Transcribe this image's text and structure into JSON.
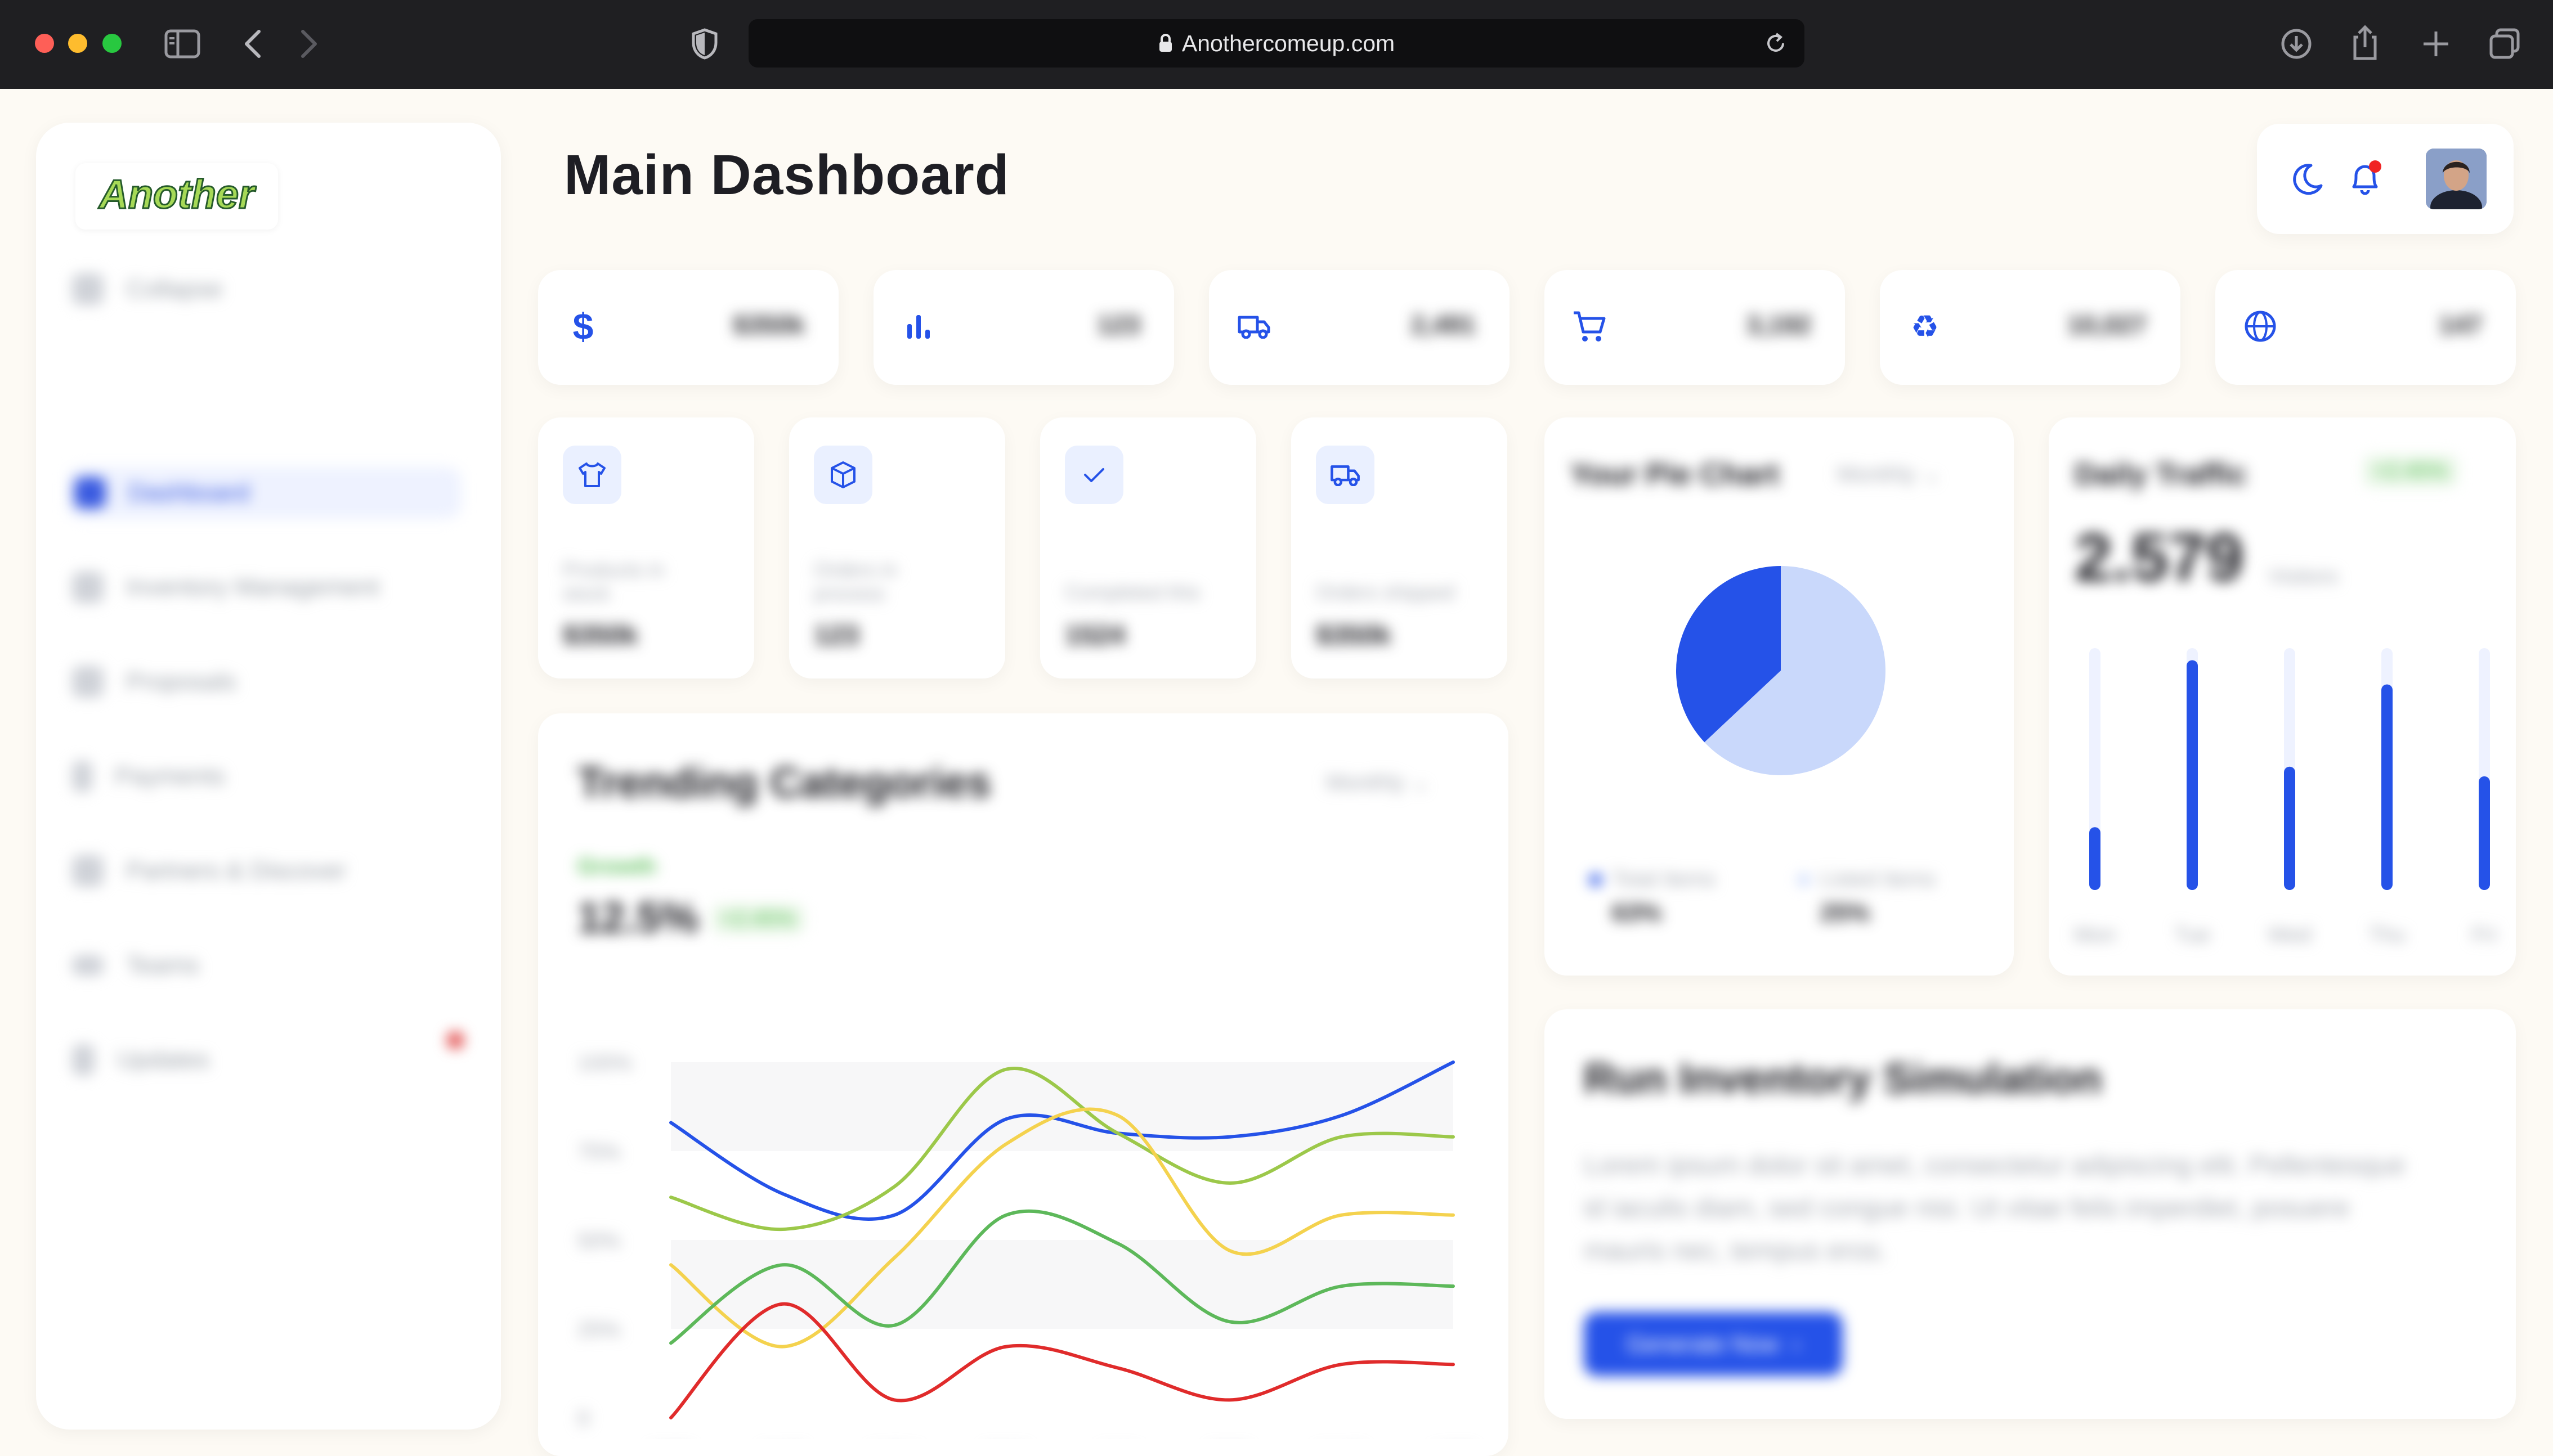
{
  "browser": {
    "url": "Anothercomeup.com"
  },
  "brand": {
    "logo_text": "Another",
    "accent": "#2552e8",
    "accent_light": "#c9d8fb"
  },
  "sidebar": {
    "collapse_label": "Collapse",
    "items": [
      {
        "label": "Dashboard"
      },
      {
        "label": "Inventory Management"
      },
      {
        "label": "Proposals"
      },
      {
        "label": "Payments"
      },
      {
        "label": "Partners & Discover"
      },
      {
        "label": "Teams"
      },
      {
        "label": "Updates"
      }
    ]
  },
  "header": {
    "title": "Main Dashboard"
  },
  "stats": [
    {
      "icon": "dollar-icon",
      "value": "$350k"
    },
    {
      "icon": "bar-chart-icon",
      "value": "123"
    },
    {
      "icon": "truck-icon",
      "value": "2,491"
    },
    {
      "icon": "cart-icon",
      "value": "3,192"
    },
    {
      "icon": "recycle-icon",
      "value": "10,027"
    },
    {
      "icon": "globe-icon",
      "value": "147"
    }
  ],
  "mini_cards": [
    {
      "icon": "shirt-icon",
      "label": "Products in stock",
      "value": "$350k"
    },
    {
      "icon": "box-icon",
      "label": "Orders in process",
      "value": "123"
    },
    {
      "icon": "check-icon",
      "label": "Completed this",
      "value": "1524"
    },
    {
      "icon": "truck-icon",
      "label": "Orders shipped",
      "value": "$350k"
    }
  ],
  "trending": {
    "title": "Trending Categories",
    "period": "Monthly",
    "growth_label": "Growth",
    "growth_value": "12.5%",
    "growth_badge": "+2.45%"
  },
  "chart_data": {
    "type": "line",
    "categories": [
      "SEP",
      "OCT",
      "NOV",
      "DEC",
      "JAN",
      "FEB",
      "MAR",
      "APR"
    ],
    "ylim": [
      0,
      100
    ],
    "yticks": [
      "100%",
      "75%",
      "50%",
      "25%",
      "0"
    ],
    "series": [
      {
        "color": "#2552e8",
        "values": [
          83,
          63,
          57,
          84,
          80,
          79,
          85,
          100
        ]
      },
      {
        "color": "#9cc84a",
        "values": [
          62,
          53,
          65,
          98,
          80,
          66,
          79,
          79
        ]
      },
      {
        "color": "#f4d24e",
        "values": [
          43,
          20,
          45,
          77,
          85,
          47,
          57,
          57
        ]
      },
      {
        "color": "#5db85a",
        "values": [
          21,
          43,
          26,
          57,
          49,
          27,
          37,
          37
        ]
      },
      {
        "color": "#e02b2b",
        "values": [
          0,
          32,
          5,
          20,
          14,
          5,
          15,
          15
        ]
      }
    ]
  },
  "pie": {
    "title": "Your Pie Chart",
    "period": "Monthly",
    "legend": [
      {
        "label": "Total Items",
        "value": "63%",
        "color": "#2552e8"
      },
      {
        "label": "Listed Items",
        "value": "25%",
        "color": "#c9d8fb"
      }
    ],
    "slices": [
      0.37,
      0.63
    ]
  },
  "traffic": {
    "title": "Daily Traffic",
    "badge": "+2.45%",
    "value": "2.579",
    "unit": "Visitors",
    "days": [
      "Mon",
      "Tue",
      "Wed",
      "Thu",
      "Fri"
    ],
    "levels": [
      0.26,
      0.95,
      0.51,
      0.85,
      0.47
    ]
  },
  "simulation": {
    "title": "Run Inventory Simulation",
    "body": "Lorem ipsum dolor sit amet, consectetur adipiscing elit. Pellentesque id iaculis diam, sed congue nisi. Ut vitae felis imperdiet, posuere mauris nec, tempus eros.",
    "button_label": "Generate Now"
  }
}
